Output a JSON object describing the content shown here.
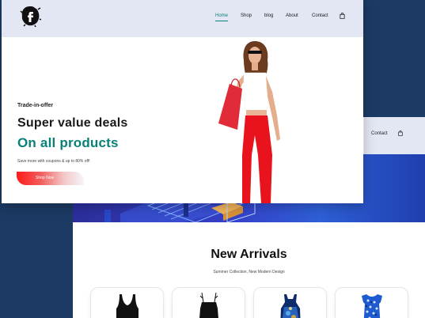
{
  "front": {
    "nav": {
      "home": "Home",
      "shop": "Shop",
      "blog": "blog",
      "about": "About",
      "contact": "Contact"
    },
    "hero": {
      "eyebrow": "Trade-in-offer",
      "title": "Super value deals",
      "subtitle": "On all products",
      "copy": "Save more with coupons & up to 80% off!",
      "button": "Shop Now"
    }
  },
  "back": {
    "nav_contact": "Contact",
    "section_title": "New Arrivals",
    "section_subtitle": "Summer Collection, New Modern Design",
    "products": [
      "black-bodysuit",
      "black-strappy-top",
      "blue-print-dress",
      "blue-pattern-dress"
    ]
  },
  "colors": {
    "accent": "#088178",
    "header_bg": "#e3e6f3",
    "page_bg": "#1c3a63",
    "button_red": "#ff1a1a"
  },
  "icons": [
    "logo-icon",
    "shopping-bag-icon"
  ]
}
